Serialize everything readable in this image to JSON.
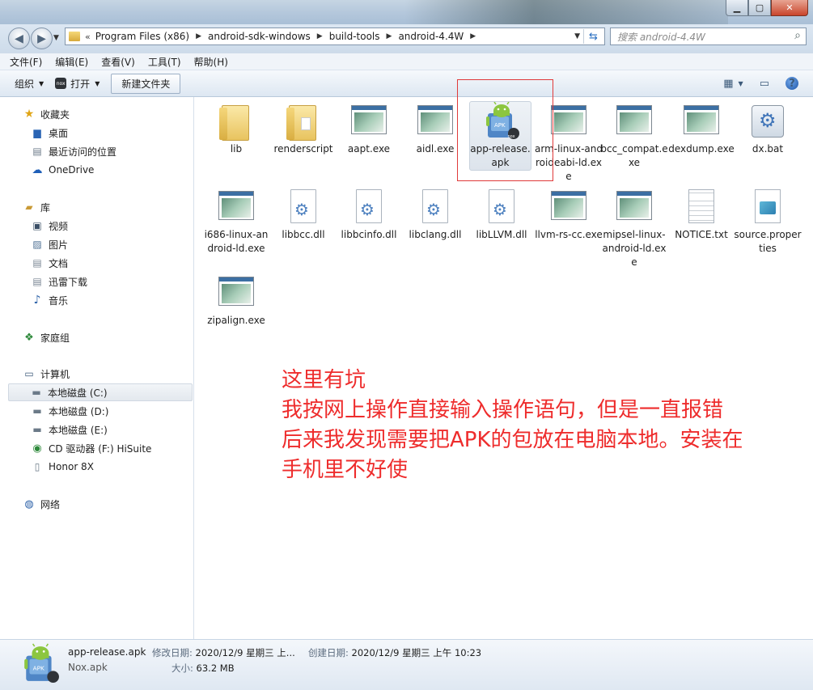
{
  "address": {
    "crumbs": [
      "Program Files (x86)",
      "android-sdk-windows",
      "build-tools",
      "android-4.4W"
    ]
  },
  "search": {
    "placeholder": "搜索 android-4.4W"
  },
  "menu": [
    "文件(F)",
    "编辑(E)",
    "查看(V)",
    "工具(T)",
    "帮助(H)"
  ],
  "toolbar": {
    "organize": "组织",
    "open": "打开",
    "new_folder": "新建文件夹"
  },
  "sidebar": {
    "favorites": "收藏夹",
    "fav_items": [
      "桌面",
      "最近访问的位置",
      "OneDrive"
    ],
    "libraries": "库",
    "lib_items": [
      "视频",
      "图片",
      "文档",
      "迅雷下载",
      "音乐"
    ],
    "homegroup": "家庭组",
    "computer": "计算机",
    "comp_items": [
      "本地磁盘 (C:)",
      "本地磁盘 (D:)",
      "本地磁盘 (E:)",
      "CD 驱动器 (F:) HiSuite",
      "Honor 8X"
    ],
    "network": "网络"
  },
  "files": [
    {
      "label": "lib",
      "icon": "folder"
    },
    {
      "label": "renderscript",
      "icon": "folder-doc"
    },
    {
      "label": "aapt.exe",
      "icon": "exe"
    },
    {
      "label": "aidl.exe",
      "icon": "exe"
    },
    {
      "label": "app-release.apk",
      "icon": "apk"
    },
    {
      "label": "arm-linux-androideabi-ld.exe",
      "icon": "exe"
    },
    {
      "label": "bcc_compat.exe",
      "icon": "exe"
    },
    {
      "label": "dexdump.exe",
      "icon": "exe"
    },
    {
      "label": "dx.bat",
      "icon": "bat"
    },
    {
      "label": "i686-linux-android-ld.exe",
      "icon": "exe"
    },
    {
      "label": "libbcc.dll",
      "icon": "dll"
    },
    {
      "label": "libbcinfo.dll",
      "icon": "dll"
    },
    {
      "label": "libclang.dll",
      "icon": "dll"
    },
    {
      "label": "libLLVM.dll",
      "icon": "dll"
    },
    {
      "label": "llvm-rs-cc.exe",
      "icon": "exe"
    },
    {
      "label": "mipsel-linux-android-ld.exe",
      "icon": "exe"
    },
    {
      "label": "NOTICE.txt",
      "icon": "txt"
    },
    {
      "label": "source.properties",
      "icon": "properties"
    },
    {
      "label": "zipalign.exe",
      "icon": "exe"
    }
  ],
  "annotation": [
    "这里有坑",
    "我按网上操作直接输入操作语句，但是一直报错",
    "后来我发现需要把APK的包放在电脑本地。安装在",
    "手机里不好使"
  ],
  "details": {
    "name": "app-release.apk",
    "type": "Nox.apk",
    "modified_label": "修改日期:",
    "modified_value": "2020/12/9 星期三 上...",
    "created_label": "创建日期:",
    "created_value": "2020/12/9 星期三 上午 10:23",
    "size_label": "大小:",
    "size_value": "63.2 MB"
  },
  "apk_badge": "nox",
  "colors": {
    "annotation": "#ee2c2c",
    "highlight": "#e03a3a"
  }
}
